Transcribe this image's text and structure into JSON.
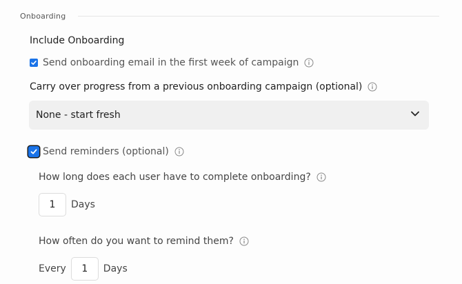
{
  "section": {
    "title": "Onboarding"
  },
  "onboarding": {
    "heading": "Include Onboarding",
    "send_email_label": "Send onboarding email in the first week of campaign",
    "carry_over_label": "Carry over progress from a previous onboarding campaign (optional)",
    "carry_over_selected": "None - start fresh",
    "reminders_label": "Send reminders (optional)",
    "duration_question": "How long does each user have to complete onboarding?",
    "duration_value": "1",
    "duration_unit": "Days",
    "frequency_question": "How often do you want to remind them?",
    "frequency_prefix": "Every",
    "frequency_value": "1",
    "frequency_unit": "Days"
  },
  "colors": {
    "checkbox_accent": "#1a73e8",
    "select_background": "#f0f0f0"
  },
  "icons": [
    "info-icon",
    "chevron-down-icon",
    "checkmark-icon"
  ]
}
